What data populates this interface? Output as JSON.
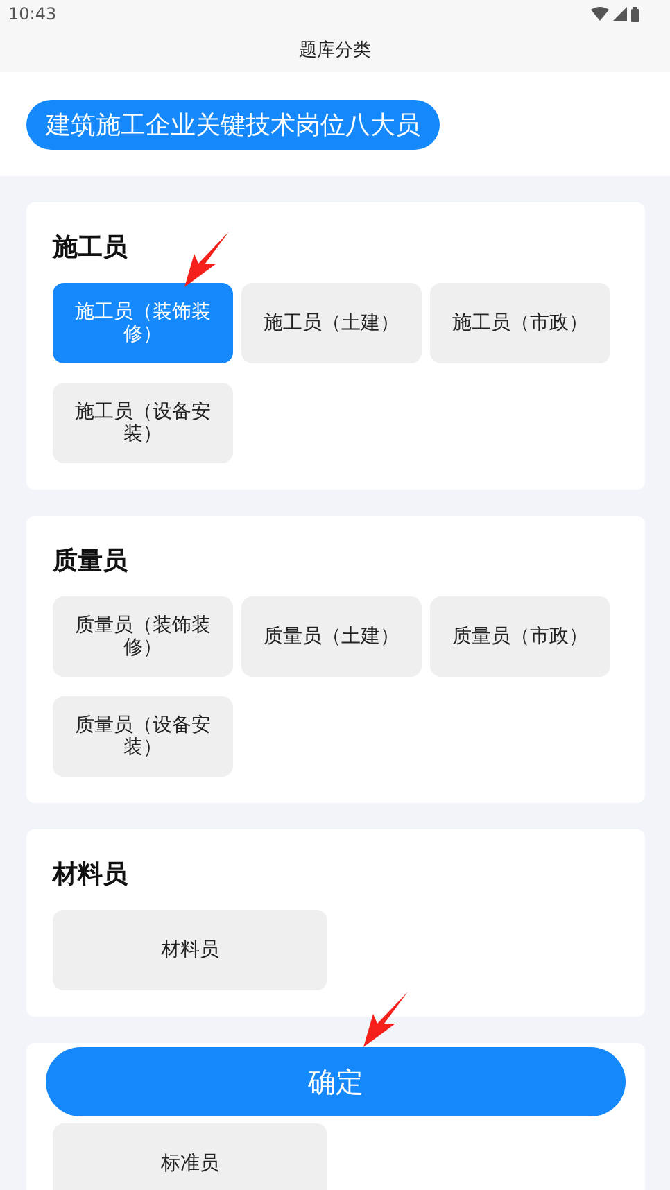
{
  "status_bar": {
    "time": "10:43"
  },
  "title_bar": {
    "title": "题库分类"
  },
  "category": {
    "label": "建筑施工企业关键技术岗位八大员",
    "selected": true
  },
  "groups": [
    {
      "title": "施工员",
      "options": [
        {
          "label": "施工员（装饰装修）",
          "selected": true
        },
        {
          "label": "施工员（土建）",
          "selected": false
        },
        {
          "label": "施工员（市政）",
          "selected": false
        },
        {
          "label": "施工员（设备安装）",
          "selected": false
        }
      ]
    },
    {
      "title": "质量员",
      "options": [
        {
          "label": "质量员（装饰装修）",
          "selected": false
        },
        {
          "label": "质量员（土建）",
          "selected": false
        },
        {
          "label": "质量员（市政）",
          "selected": false
        },
        {
          "label": "质量员（设备安装）",
          "selected": false
        }
      ]
    },
    {
      "title": "材料员",
      "options": [
        {
          "label": "材料员",
          "selected": false
        }
      ]
    },
    {
      "options": [
        {
          "label": "标准员",
          "selected": false
        }
      ]
    }
  ],
  "confirm_button": {
    "label": "确定"
  }
}
